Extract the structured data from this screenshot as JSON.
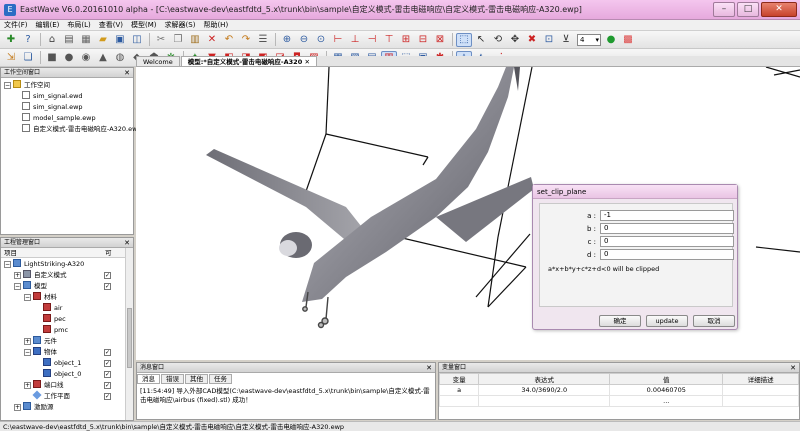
{
  "window": {
    "title": "EastWave V6.0.20161010 alpha - [C:\\eastwave-dev\\eastfdtd_5.x\\trunk\\bin\\sample\\自定义模式-雷击电磁响应\\自定义模式-雷击电磁响应-A320.ewp]",
    "icon": "app-icon"
  },
  "menu": [
    "文件(F)",
    "编辑(E)",
    "布局(L)",
    "查看(V)",
    "模型(M)",
    "求解器(S)",
    "帮助(H)"
  ],
  "toolbar": {
    "zoom_value": "4"
  },
  "workspace": {
    "title": "工作空间窗口",
    "root": "工作空间",
    "files": [
      "sim_signal.ewd",
      "sim_signal.ewp",
      "model_sample.ewp",
      "自定义模式-雷击电磁响应-A320.ewp"
    ]
  },
  "project": {
    "title": "工程管理窗口",
    "col_item": "项目",
    "col_check": "可",
    "items": [
      {
        "label": "LightStriking-A320",
        "indent": 0,
        "icon": "cube",
        "exp": "−"
      },
      {
        "label": "自定义模式",
        "indent": 1,
        "icon": "grey",
        "exp": "+",
        "check": true
      },
      {
        "label": "模型",
        "indent": 1,
        "icon": "cube",
        "exp": "−",
        "check": true
      },
      {
        "label": "材料",
        "indent": 2,
        "icon": "red",
        "exp": "−"
      },
      {
        "label": "air",
        "indent": 3,
        "icon": "red"
      },
      {
        "label": "pec",
        "indent": 3,
        "icon": "red"
      },
      {
        "label": "pmc",
        "indent": 3,
        "icon": "red"
      },
      {
        "label": "元件",
        "indent": 2,
        "icon": "cube",
        "exp": "+"
      },
      {
        "label": "物体",
        "indent": 2,
        "icon": "blue",
        "exp": "−",
        "check": true
      },
      {
        "label": "object_1",
        "indent": 3,
        "icon": "blue",
        "check": true
      },
      {
        "label": "object_0",
        "indent": 3,
        "icon": "blue",
        "check": true
      },
      {
        "label": "端口线",
        "indent": 2,
        "icon": "red",
        "exp": "+",
        "check": true
      },
      {
        "label": "工作平面",
        "indent": 2,
        "icon": "diamond",
        "check": true
      },
      {
        "label": "激励源",
        "indent": 1,
        "icon": "cube",
        "exp": "+"
      }
    ]
  },
  "tabs": [
    {
      "label": "Welcome",
      "active": false
    },
    {
      "label": "模型:*自定义模式-雷击电磁响应-A320",
      "active": true
    }
  ],
  "dialog": {
    "title": "set_clip_plane",
    "fields": [
      {
        "label": "a :",
        "value": "-1"
      },
      {
        "label": "b :",
        "value": "0"
      },
      {
        "label": "c :",
        "value": "0"
      },
      {
        "label": "d :",
        "value": "0"
      }
    ],
    "hint": "a*x+b*y+c*z+d<0 will be clipped",
    "buttons": {
      "ok": "确定",
      "update": "update",
      "cancel": "取消"
    }
  },
  "messages": {
    "title": "消息窗口",
    "tabs": [
      "消息",
      "错误",
      "其他",
      "任务"
    ],
    "text": "[11:54:49] 导入外部CAD模型(C:\\eastwave-dev\\eastfdtd_5.x\\trunk\\bin\\sample\\自定义模式-雷击电磁响应\\airbus (fixed).stl) 成功！"
  },
  "variables": {
    "title": "变量窗口",
    "headers": [
      "变量",
      "表达式",
      "值",
      "详细描述"
    ],
    "rows": [
      {
        "name": "a",
        "expr": "34.0/3690/2.0",
        "value": "0.00460705",
        "desc": ""
      },
      {
        "name": "",
        "expr": "",
        "value": "...",
        "desc": ""
      }
    ]
  },
  "status": "C:\\eastwave-dev\\eastfdtd_5.x\\trunk\\bin\\sample\\自定义模式-雷击电磁响应\\自定义模式-雷击电磁响应-A320.ewp"
}
